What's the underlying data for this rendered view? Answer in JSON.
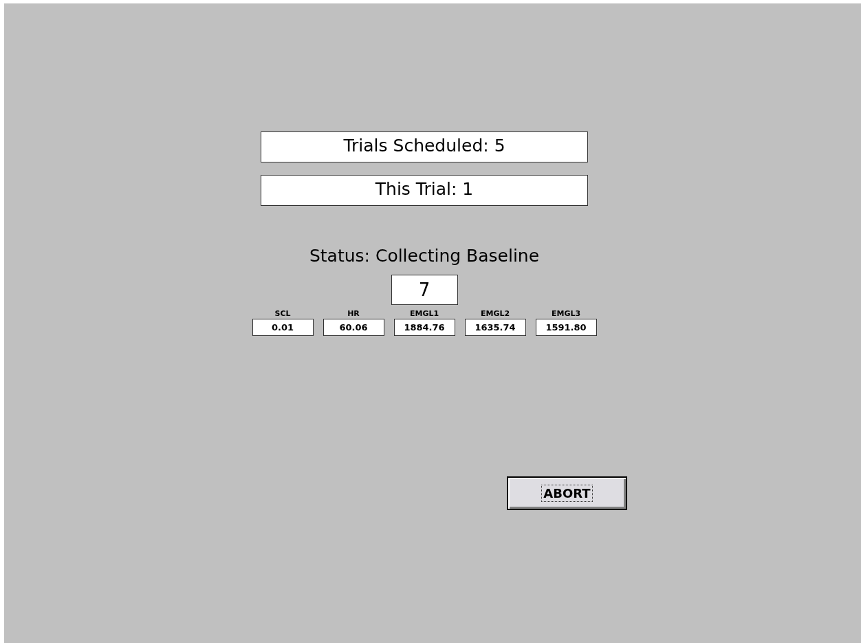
{
  "trials_scheduled": "Trials Scheduled: 5",
  "this_trial": "This Trial: 1",
  "status": "Status: Collecting Baseline",
  "counter": "7",
  "readings": [
    {
      "label": "SCL",
      "value": "0.01"
    },
    {
      "label": "HR",
      "value": "60.06"
    },
    {
      "label": "EMGL1",
      "value": "1884.76"
    },
    {
      "label": "EMGL2",
      "value": "1635.74"
    },
    {
      "label": "EMGL3",
      "value": "1591.80"
    }
  ],
  "abort_button": {
    "label": "ABORT",
    "focused": true
  }
}
